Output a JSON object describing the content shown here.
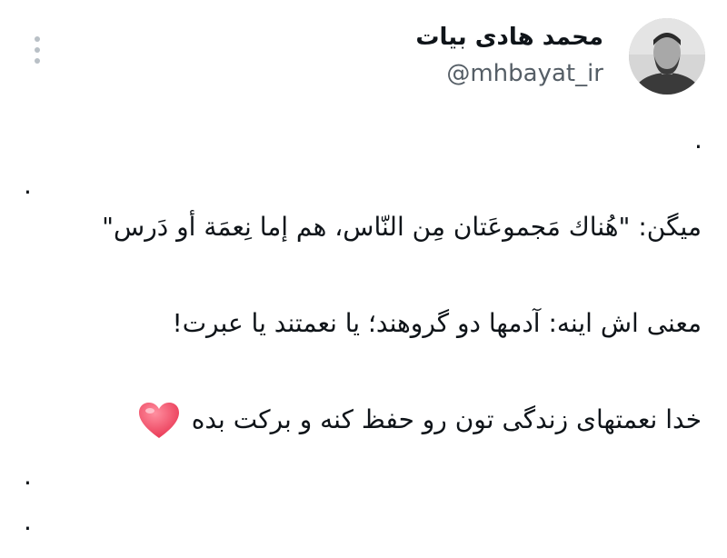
{
  "user": {
    "display_name": "محمد هادی بیات",
    "handle": "@mhbayat_ir"
  },
  "icons": {
    "more": "more-vertical-icon",
    "heart": "heart-icon"
  },
  "tweet": {
    "dot": ".",
    "line1": "میگن: \"هُناك مَجموعَتان مِن النّاس، هم إما نِعمَة أو دَرس\"",
    "line2": "معنی اش اینه: آدمها دو گروهند؛ یا نعمتند یا عبرت!",
    "line3": "خدا نعمتهای زندگی تون رو حفظ کنه و برکت بده"
  },
  "colors": {
    "text": "#0f1419",
    "secondary": "#555e66",
    "heart": "#f1475f"
  }
}
